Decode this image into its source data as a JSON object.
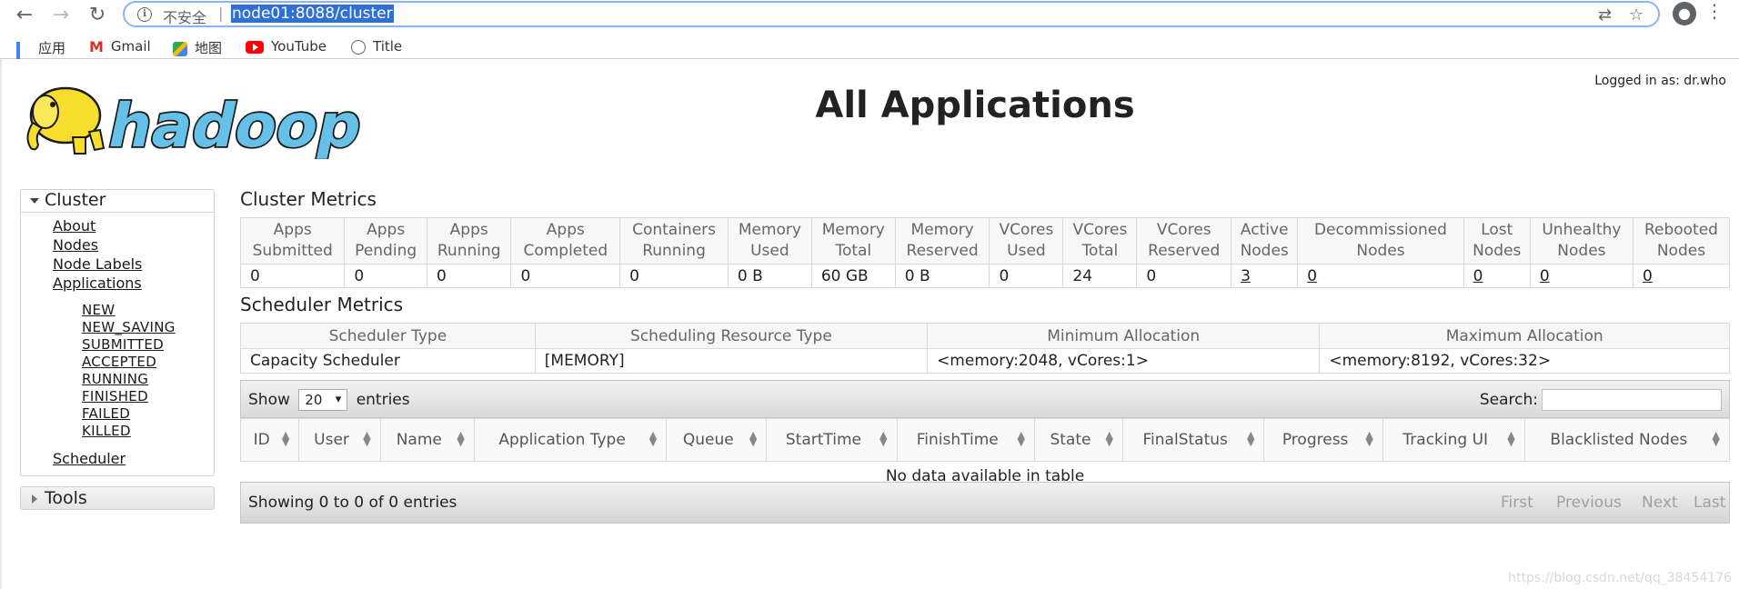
{
  "browser": {
    "back_icon": "arrow-left-icon",
    "insecure_label": "不安全",
    "url": "node01:8088/cluster",
    "bookmarks": [
      {
        "label": "应用",
        "icon": "apps-icon"
      },
      {
        "label": "Gmail",
        "icon": "gmail-icon"
      },
      {
        "label": "地图",
        "icon": "maps-icon"
      },
      {
        "label": "YouTube",
        "icon": "youtube-icon"
      },
      {
        "label": "Title",
        "icon": "globe-icon"
      }
    ]
  },
  "header": {
    "logged_in": "Logged in as: dr.who",
    "title": "All Applications",
    "logo_text": "hadoop"
  },
  "sidebar": {
    "cluster_label": "Cluster",
    "links": [
      "About",
      "Nodes",
      "Node Labels",
      "Applications"
    ],
    "app_states": [
      "NEW",
      "NEW_SAVING",
      "SUBMITTED",
      "ACCEPTED",
      "RUNNING",
      "FINISHED",
      "FAILED",
      "KILLED"
    ],
    "scheduler": "Scheduler",
    "tools_label": "Tools"
  },
  "cluster_metrics": {
    "title": "Cluster Metrics",
    "headers": [
      [
        "Apps",
        "Submitted"
      ],
      [
        "Apps",
        "Pending"
      ],
      [
        "Apps",
        "Running"
      ],
      [
        "Apps",
        "Completed"
      ],
      [
        "Containers",
        "Running"
      ],
      [
        "Memory",
        "Used"
      ],
      [
        "Memory",
        "Total"
      ],
      [
        "Memory",
        "Reserved"
      ],
      [
        "VCores",
        "Used"
      ],
      [
        "VCores",
        "Total"
      ],
      [
        "VCores",
        "Reserved"
      ],
      [
        "Active",
        "Nodes"
      ],
      [
        "Decommissioned",
        "Nodes"
      ],
      [
        "Lost",
        "Nodes"
      ],
      [
        "Unhealthy",
        "Nodes"
      ],
      [
        "Rebooted",
        "Nodes"
      ]
    ],
    "values": [
      "0",
      "0",
      "0",
      "0",
      "0",
      "0 B",
      "60 GB",
      "0 B",
      "0",
      "24",
      "0",
      "3",
      "0",
      "0",
      "0",
      "0"
    ]
  },
  "scheduler_metrics": {
    "title": "Scheduler Metrics",
    "headers": [
      "Scheduler Type",
      "Scheduling Resource Type",
      "Minimum Allocation",
      "Maximum Allocation"
    ],
    "values": [
      "Capacity Scheduler",
      "[MEMORY]",
      "<memory:2048, vCores:1>",
      "<memory:8192, vCores:32>"
    ]
  },
  "apps_table": {
    "show_label": "Show",
    "page_size": "20",
    "entries_label": "entries",
    "search_label": "Search:",
    "columns": [
      "ID",
      "User",
      "Name",
      "Application Type",
      "Queue",
      "StartTime",
      "FinishTime",
      "State",
      "FinalStatus",
      "Progress",
      "Tracking UI",
      "Blacklisted Nodes"
    ],
    "empty_message": "No data available in table",
    "info": "Showing 0 to 0 of 0 entries",
    "pager": [
      "First",
      "Previous",
      "Next",
      "Last"
    ]
  },
  "watermark": "https://blog.csdn.net/qq_38454176"
}
